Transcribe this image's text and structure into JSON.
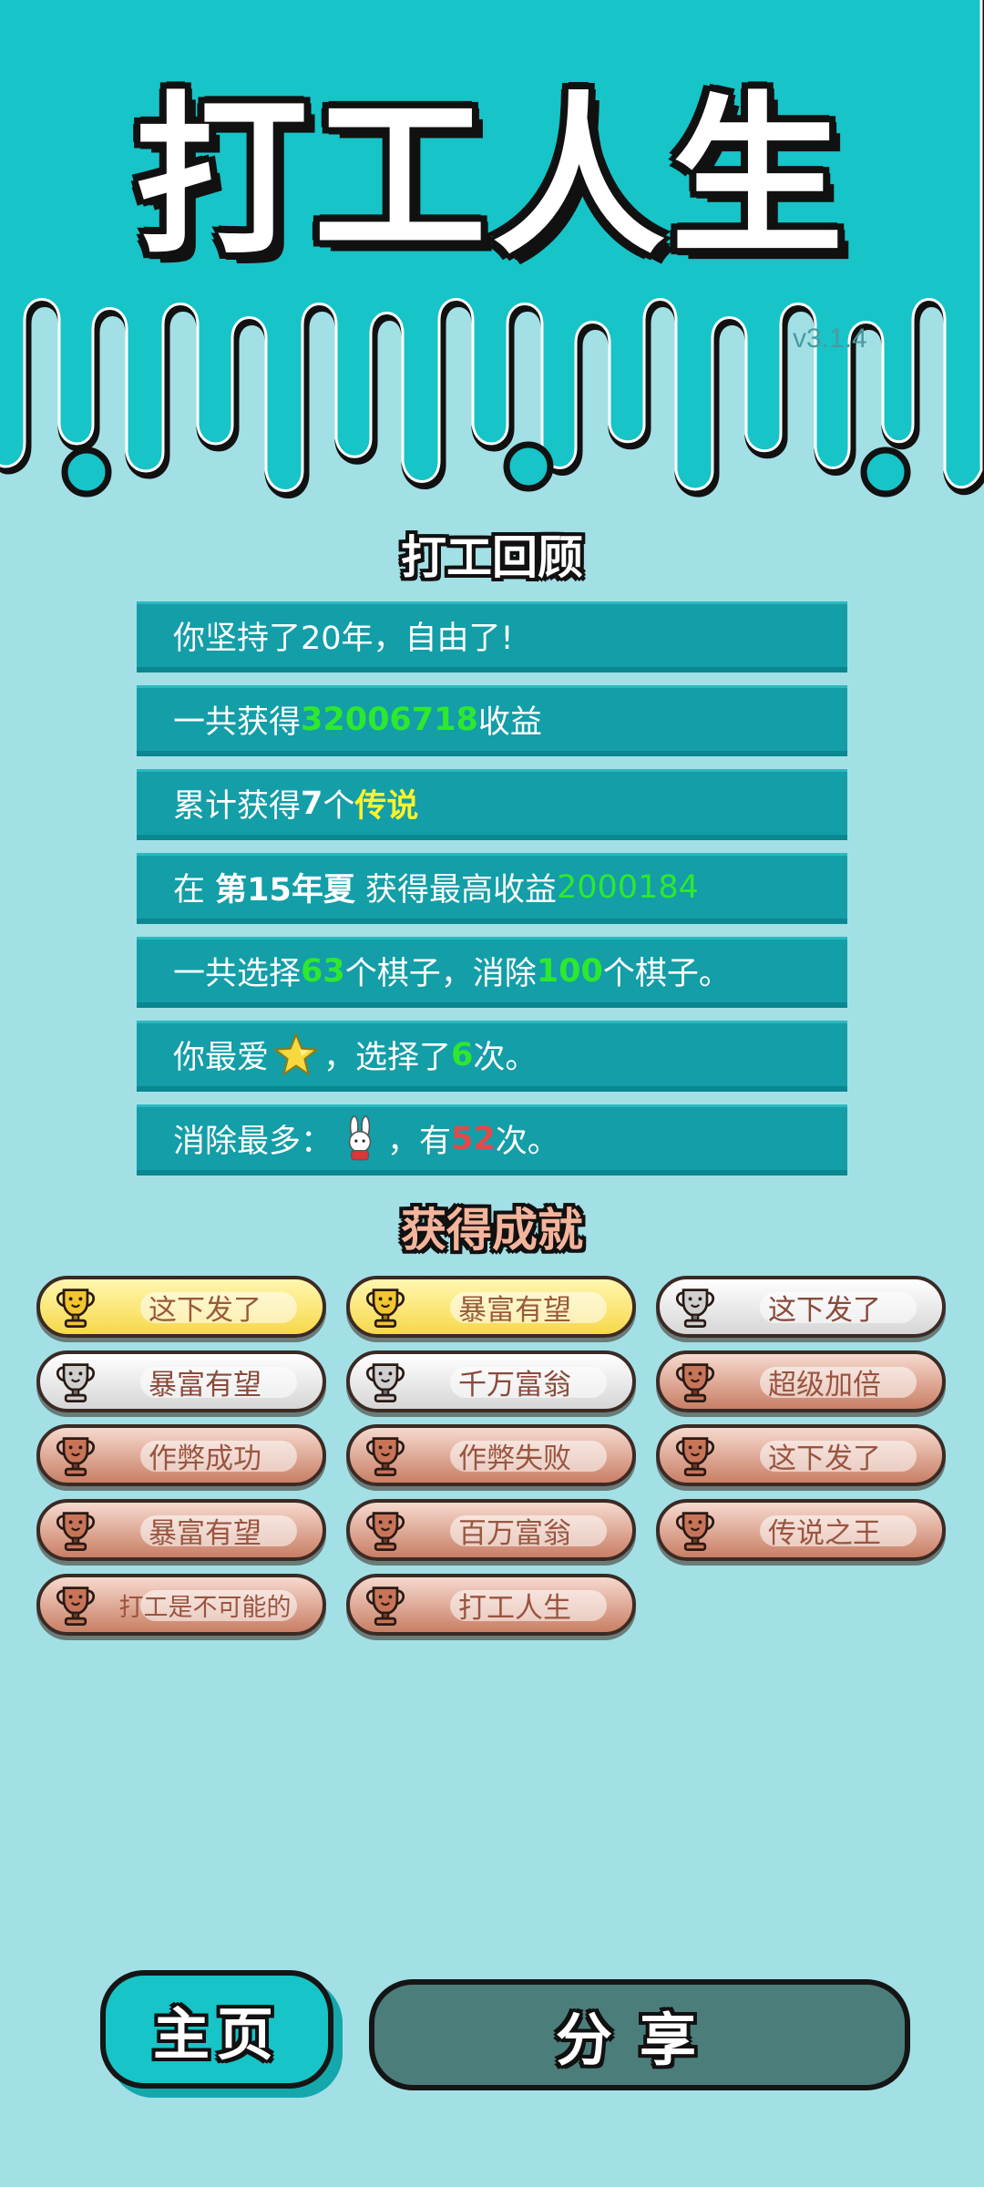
{
  "header": {
    "title": "打工人生",
    "version": "v3.1.4"
  },
  "review": {
    "title": "打工回顾",
    "rows": [
      {
        "text": "你坚持了20年，自由了!"
      },
      {
        "pre": "一共获得",
        "value": "32006718",
        "post": "收益"
      },
      {
        "pre": "累计获得",
        "count": "7",
        "mid": "个",
        "value": "传说"
      },
      {
        "pre": "在 ",
        "season": "第15年夏",
        "mid": " 获得最高收益",
        "value": "2000184"
      },
      {
        "pre": "一共选择",
        "chosen": "63",
        "mid": "个棋子，消除",
        "removed": "100",
        "post": "个棋子。"
      },
      {
        "pre": "你最爱",
        "icon": "star-icon",
        "mid": "，选择了",
        "times": "6",
        "post": "次。"
      },
      {
        "pre": "消除最多：",
        "icon": "rabbit-icon",
        "mid": "，有",
        "times": "52",
        "post": "次。"
      }
    ]
  },
  "achievements": {
    "title": "获得成就",
    "items": [
      {
        "label": "这下发了",
        "tier": "gold"
      },
      {
        "label": "暴富有望",
        "tier": "gold"
      },
      {
        "label": "这下发了",
        "tier": "silver"
      },
      {
        "label": "暴富有望",
        "tier": "silver"
      },
      {
        "label": "千万富翁",
        "tier": "silver"
      },
      {
        "label": "超级加倍",
        "tier": "bronze"
      },
      {
        "label": "作弊成功",
        "tier": "bronze"
      },
      {
        "label": "作弊失败",
        "tier": "bronze"
      },
      {
        "label": "这下发了",
        "tier": "bronze"
      },
      {
        "label": "暴富有望",
        "tier": "bronze"
      },
      {
        "label": "百万富翁",
        "tier": "bronze"
      },
      {
        "label": "传说之王",
        "tier": "bronze"
      },
      {
        "label": "打工是不可能的",
        "tier": "bronze"
      },
      {
        "label": "打工人生",
        "tier": "bronze"
      }
    ]
  },
  "buttons": {
    "home": "主页",
    "share": "分享"
  },
  "colors": {
    "background": "#a2e0e6",
    "header": "#17c4c8",
    "row": "#139ea8",
    "green": "#2ee82e",
    "yellow": "#fff32a",
    "red": "#e24a4a",
    "gold": "#f7d84a",
    "silver": "#d6d6d6",
    "bronze": "#c97f65"
  }
}
